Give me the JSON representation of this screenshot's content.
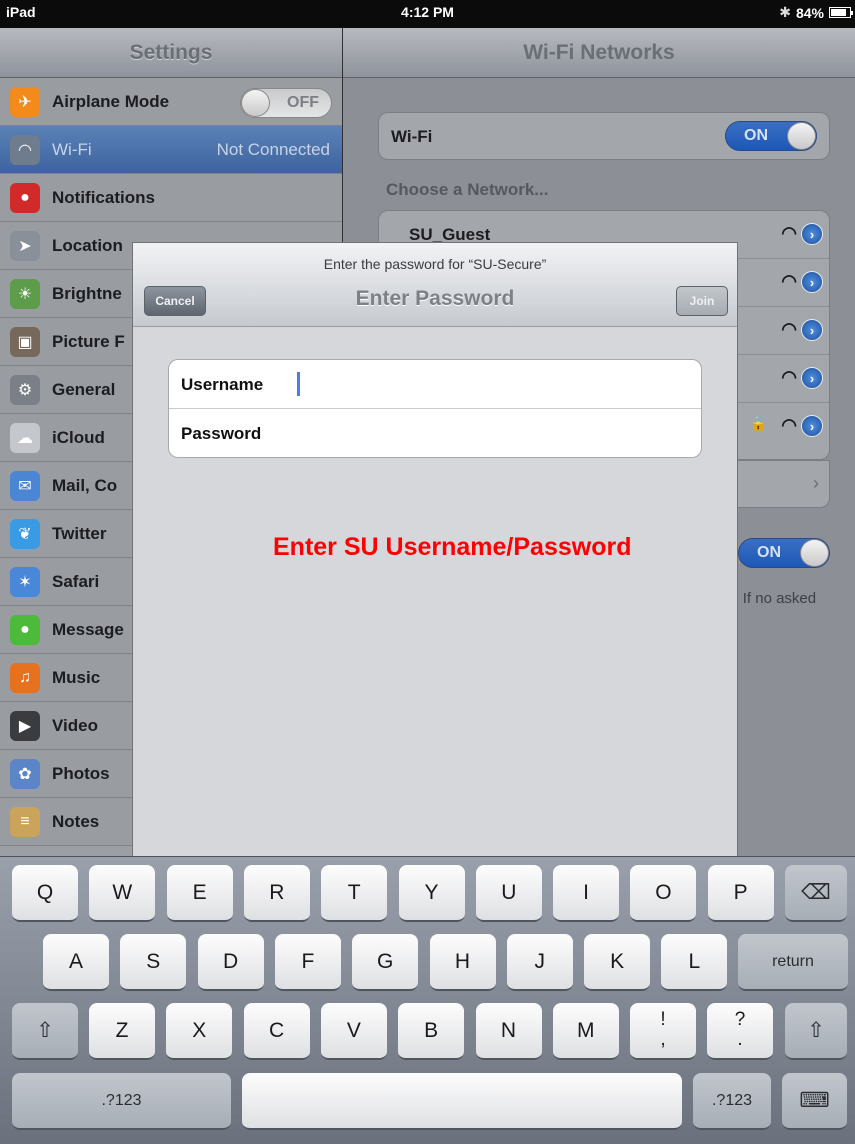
{
  "status_bar": {
    "carrier": "iPad",
    "time": "4:12 PM",
    "battery": "84%",
    "battery_level": 0.84
  },
  "master": {
    "title": "Settings",
    "items": [
      {
        "label": "Airplane Mode",
        "icon": "airplane-icon",
        "color": "#f28b1c",
        "toggle": "OFF"
      },
      {
        "label": "Wi-Fi",
        "icon": "wifi-icon",
        "color": "#6f7c8e",
        "value": "Not Connected",
        "selected": true
      },
      {
        "label": "Notifications",
        "icon": "notifications-icon",
        "color": "#d22a2a"
      },
      {
        "label": "Location",
        "icon": "location-icon",
        "color": "#8a9099"
      },
      {
        "label": "Brightne",
        "icon": "brightness-icon",
        "color": "#5d9c4a"
      },
      {
        "label": "Picture F",
        "icon": "picture-frame-icon",
        "color": "#76685a"
      },
      {
        "label": "General",
        "icon": "gear-icon",
        "color": "#7b8088"
      },
      {
        "label": "iCloud",
        "icon": "cloud-icon",
        "color": "#c4c8cd"
      },
      {
        "label": "Mail, Co",
        "icon": "mail-icon",
        "color": "#4a86d4"
      },
      {
        "label": "Twitter",
        "icon": "twitter-icon",
        "color": "#3a9be4"
      },
      {
        "label": "Safari",
        "icon": "compass-icon",
        "color": "#4b87d9"
      },
      {
        "label": "Message",
        "icon": "message-icon",
        "color": "#4dba3c"
      },
      {
        "label": "Music",
        "icon": "music-icon",
        "color": "#e6711e"
      },
      {
        "label": "Video",
        "icon": "video-icon",
        "color": "#3a3c40"
      },
      {
        "label": "Photos",
        "icon": "sunflower-icon",
        "color": "#5b85c6"
      },
      {
        "label": "Notes",
        "icon": "notes-icon",
        "color": "#c9a45a"
      }
    ]
  },
  "detail": {
    "title": "Wi-Fi Networks",
    "wifi_label": "Wi-Fi",
    "wifi_toggle": "ON",
    "choose_label": "Choose a Network...",
    "networks": [
      {
        "name": "SU_Guest",
        "secure": false
      },
      {
        "name": "",
        "secure": false
      },
      {
        "name": "",
        "secure": false
      },
      {
        "name": "",
        "secure": false
      },
      {
        "name": "",
        "secure": true
      }
    ],
    "ask_toggle": "ON",
    "footnote": "y.  If no asked"
  },
  "modal": {
    "prompt": "Enter the password for “SU-Secure”",
    "title": "Enter Password",
    "cancel": "Cancel",
    "join": "Join",
    "username_label": "Username",
    "password_label": "Password",
    "username_value": "",
    "password_value": "",
    "instruction": "Enter SU Username/Password"
  },
  "keyboard": {
    "row1": [
      "Q",
      "W",
      "E",
      "R",
      "T",
      "Y",
      "U",
      "I",
      "O",
      "P"
    ],
    "row2": [
      "A",
      "S",
      "D",
      "F",
      "G",
      "H",
      "J",
      "K",
      "L"
    ],
    "row3": [
      "Z",
      "X",
      "C",
      "V",
      "B",
      "N",
      "M"
    ],
    "punct1": [
      "!",
      ","
    ],
    "punct2": [
      "?",
      "."
    ],
    "return": "return",
    "numbers": ".?123",
    "shift_icon": "shift-icon",
    "backspace_icon": "backspace-icon",
    "hide_keyboard_icon": "hide-keyboard-icon"
  },
  "colors": {
    "accent": "#3a6fc3",
    "note": "#ff0000",
    "selected_row": "#4a6fab"
  }
}
